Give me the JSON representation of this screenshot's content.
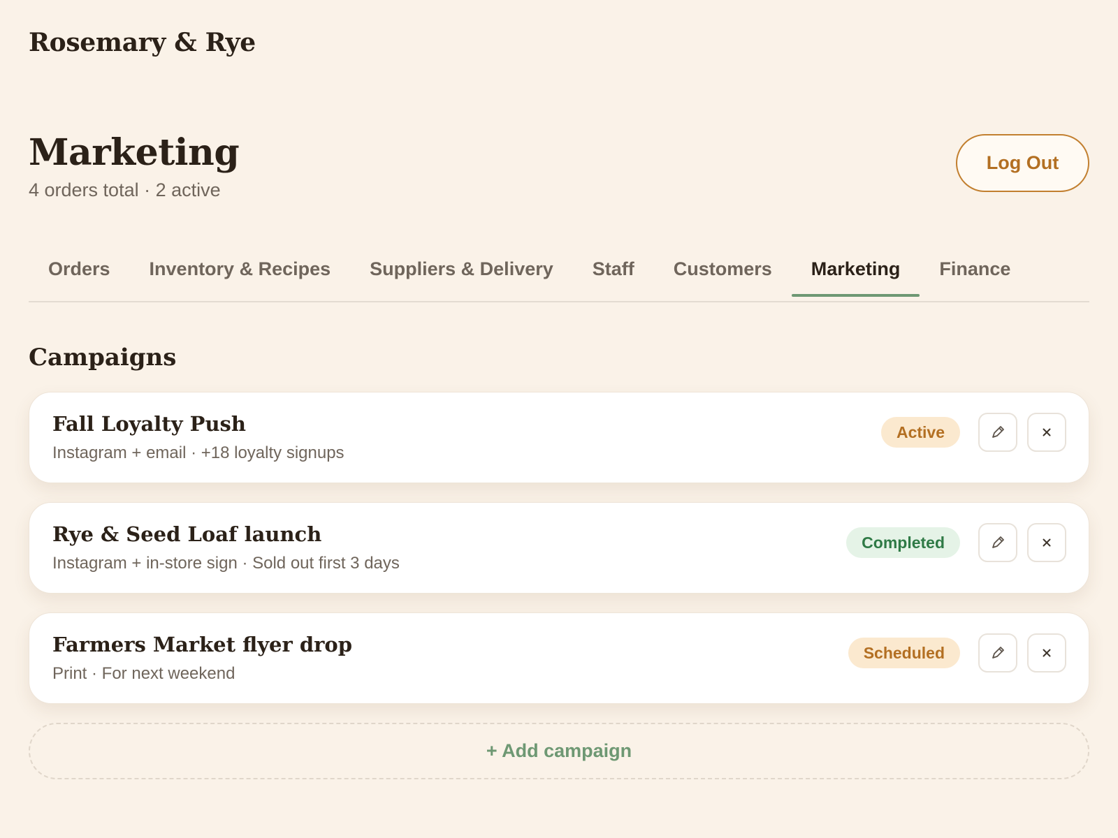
{
  "app": {
    "brand": "Rosemary & Rye"
  },
  "header": {
    "title": "Marketing",
    "subtitle": "4 orders total · 2 active",
    "logout_label": "Log Out"
  },
  "tabs": [
    {
      "label": "Orders",
      "active": false
    },
    {
      "label": "Inventory & Recipes",
      "active": false
    },
    {
      "label": "Suppliers & Delivery",
      "active": false
    },
    {
      "label": "Staff",
      "active": false
    },
    {
      "label": "Customers",
      "active": false
    },
    {
      "label": "Marketing",
      "active": true
    },
    {
      "label": "Finance",
      "active": false
    }
  ],
  "campaigns": {
    "title": "Campaigns",
    "items": [
      {
        "name": "Fall Loyalty Push",
        "meta": "Instagram + email · +18 loyalty signups",
        "status": "Active",
        "status_kind": "active"
      },
      {
        "name": "Rye & Seed Loaf launch",
        "meta": "Instagram + in-store sign · Sold out first 3 days",
        "status": "Completed",
        "status_kind": "completed"
      },
      {
        "name": "Farmers Market flyer drop",
        "meta": "Print · For next weekend",
        "status": "Scheduled",
        "status_kind": "scheduled"
      }
    ],
    "add_label": "+ Add campaign"
  },
  "icons": {
    "edit": "pencil-icon",
    "delete": "close-icon"
  },
  "colors": {
    "background": "#faf2e8",
    "accent_orange": "#c27f2f",
    "accent_green": "#6e9873",
    "badge_active_bg": "#fbe9cf",
    "badge_completed_bg": "#e5f3e7"
  }
}
